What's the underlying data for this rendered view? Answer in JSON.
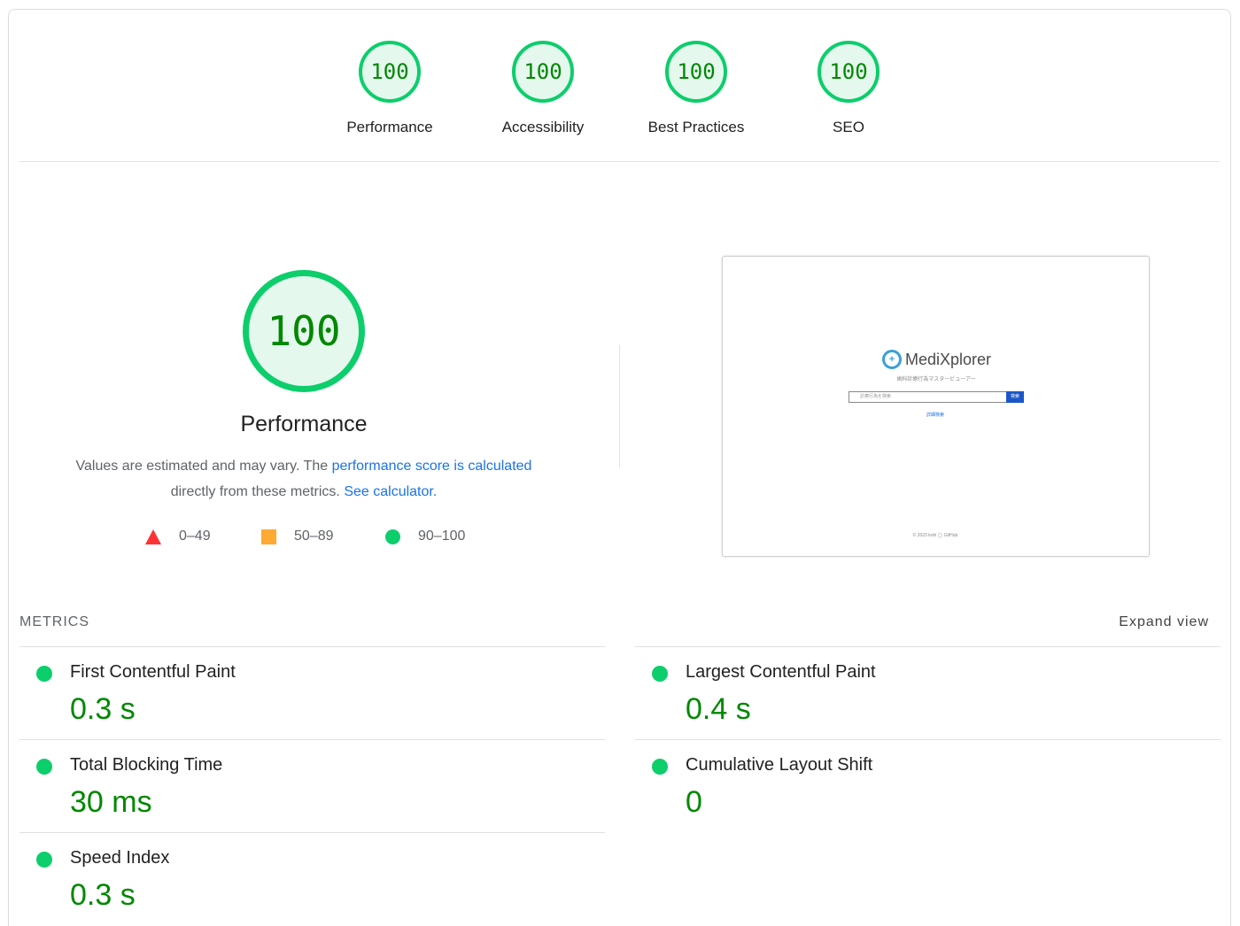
{
  "gauges": [
    {
      "score": "100",
      "label": "Performance"
    },
    {
      "score": "100",
      "label": "Accessibility"
    },
    {
      "score": "100",
      "label": "Best Practices"
    },
    {
      "score": "100",
      "label": "SEO"
    }
  ],
  "performance": {
    "score": "100",
    "title": "Performance",
    "desc_prefix": "Values are estimated and may vary. The ",
    "desc_link": "performance score is calculated",
    "desc_middle": " directly from these metrics. ",
    "desc_calc_link": "See calculator.",
    "legend": [
      {
        "range": "0–49",
        "icon": "red-triangle-icon"
      },
      {
        "range": "50–89",
        "icon": "orange-square-icon"
      },
      {
        "range": "90–100",
        "icon": "green-circle-icon"
      }
    ]
  },
  "thumbnail": {
    "app_name": "MediXplorer",
    "subtitle": "歯科診療行為マスタービューアー",
    "search_placeholder": "診療行為を検索",
    "search_button": "検索",
    "link": "詳細検索",
    "footer": "© 2023 kohi  ◯ GitHub"
  },
  "metrics": {
    "heading": "METRICS",
    "expand_label": "Expand view",
    "items": [
      {
        "title": "First Contentful Paint",
        "value": "0.3 s"
      },
      {
        "title": "Largest Contentful Paint",
        "value": "0.4 s"
      },
      {
        "title": "Total Blocking Time",
        "value": "30 ms"
      },
      {
        "title": "Cumulative Layout Shift",
        "value": "0"
      },
      {
        "title": "Speed Index",
        "value": "0.3 s"
      }
    ]
  },
  "colors": {
    "pass": "#0cce6b",
    "pass_text": "#008800",
    "average": "#ffaa33",
    "fail": "#ff3333",
    "link": "#1a73e8"
  }
}
